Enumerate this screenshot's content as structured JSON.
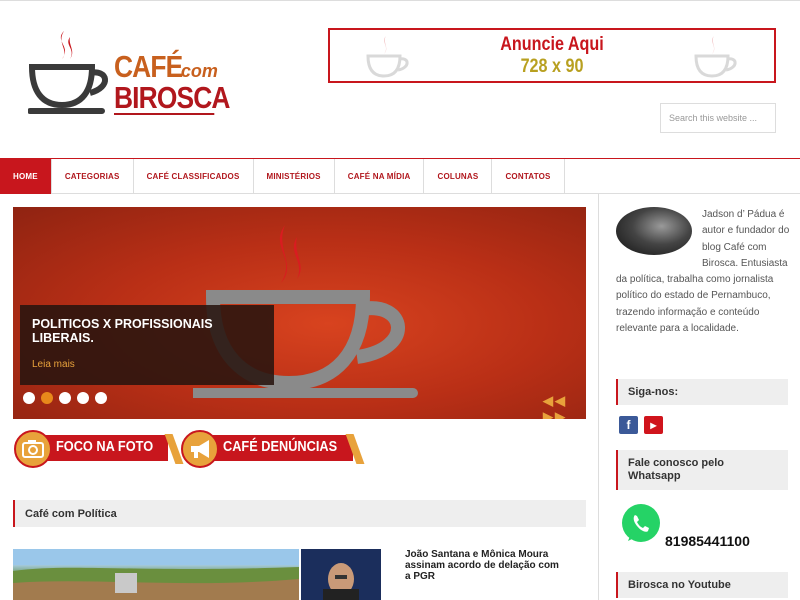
{
  "header": {
    "logo_cafe": "CAFÉ",
    "logo_com": "com",
    "logo_birosca": "BIROSCA",
    "ad_line1": "Anuncie Aqui",
    "ad_line2": "728 x 90",
    "search_placeholder": "Search this website ..."
  },
  "nav": {
    "items": [
      {
        "label": "HOME"
      },
      {
        "label": "CATEGORIAS"
      },
      {
        "label": "CAFÉ CLASSIFICADOS"
      },
      {
        "label": "MINISTÉRIOS"
      },
      {
        "label": "CAFÉ NA MÍDIA"
      },
      {
        "label": "COLUNAS"
      },
      {
        "label": "CONTATOS"
      }
    ],
    "active_index": 0
  },
  "slider": {
    "title": "POLITICOS X PROFISSIONAIS LIBERAIS.",
    "link": "Leia mais",
    "dot_count": 5,
    "active_dot": 1,
    "arrows": "◀◀ ▶▶"
  },
  "banners": {
    "foco": "FOCO NA FOTO",
    "denuncias": "CAFÉ DENÚNCIAS"
  },
  "section": {
    "title": "Café com Política"
  },
  "news": {
    "title": "João Santana e Mônica Moura assinam acordo de delação com a PGR"
  },
  "sidebar": {
    "author_text": "Jadson d’ Pádua é autor e fundador do blog Café com Birosca. Entusiasta da política, trabalha como jornalista político do estado de Pernambuco, trazendo informação e conteúdo relevante para a localidade.",
    "siga": "Siga-nos:",
    "facebook_glyph": "f",
    "youtube_glyph": "▶",
    "fale": "Fale conosco pelo Whatsapp",
    "whatsapp_number": "81985441100",
    "youtube_widget": "Birosca no Youtube"
  },
  "colors": {
    "accent": "#c8161d",
    "orange": "#e8a23b",
    "logo_orange": "#c8601e"
  }
}
